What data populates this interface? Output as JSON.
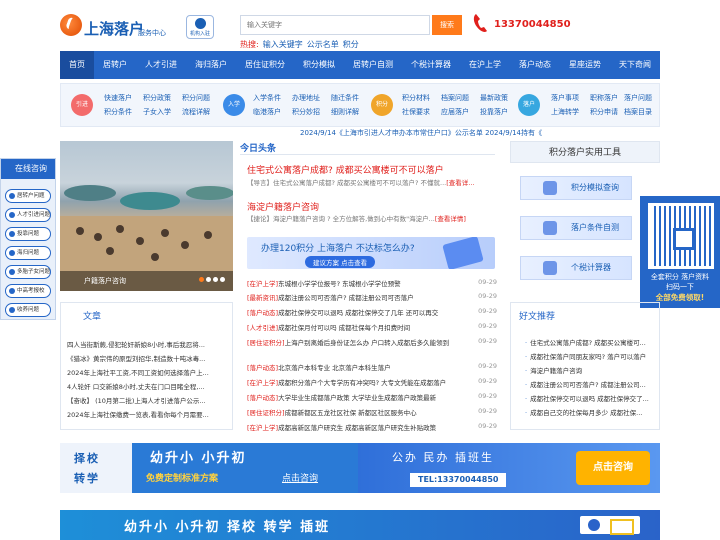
{
  "header": {
    "logo_text": "上海落户",
    "logo_sub": "服务中心",
    "org_badge": "机构入驻",
    "search_placeholder": "输入关键字",
    "search_button": "搜索",
    "hot_label": "热搜:",
    "hot_words": [
      "输入关键字",
      "公示名单",
      "积分"
    ],
    "phone": "13370044850"
  },
  "nav": [
    "首页",
    "居转户",
    "人才引进",
    "海归落户",
    "居住证积分",
    "积分模拟",
    "居转户自测",
    "个税计算器",
    "在沪上学",
    "落户动态",
    "星座运势",
    "天下奇闻"
  ],
  "categories": [
    {
      "badge": "引进",
      "color": "#f36b6b",
      "links": [
        "快速落户",
        "积分政策",
        "积分问题",
        "积分条件",
        "子女入学",
        "流程详解"
      ]
    },
    {
      "badge": "入学",
      "color": "#3b8be8",
      "links": [
        "入学条件",
        "办理地址",
        "随迁条件",
        "临港落户",
        "积分妙招",
        "细则详解"
      ]
    },
    {
      "badge": "积分",
      "color": "#f0a52a",
      "links": [
        "积分材料",
        "档案问题",
        "最新政策",
        "社保要求",
        "应届落户",
        "投靠落户"
      ]
    },
    {
      "badge": "落户",
      "color": "#37a7e0",
      "links": [
        "落户事项",
        "职称落户",
        "落户问题",
        "上海转学",
        "积分申请",
        "档案目录"
      ]
    }
  ],
  "ticker": "2024/9/14《上海市引进人才申办本市常住户口》公示名单   2024/9/14持有《",
  "photo_caption": "户籍落户咨询",
  "consult": {
    "title": "在线咨询",
    "items": [
      "居转户问题",
      "人才引进问题",
      "投靠问题",
      "海归问题",
      "多胎子女问题",
      "中高考报校",
      "收养问题"
    ]
  },
  "left_news": {
    "title": "文章",
    "items": [
      "四人当街斯蕨,侵犯轮奸新娘8小时,事后我忍将...",
      "《猎冰》黄宗伟的原型刘招华,制造数十吨冰毒...",
      "2024年上海社平工资,不同工资如何选择落户上...",
      "4人轮奸 口交新娘8小时,丈夫在门口目睹全程,...",
      "【奋收】 (10月第二批)上海人才引进落户公示...",
      "2024年上海社保缴费一览表,看看你每个月需要..."
    ]
  },
  "today": {
    "title": "今日头条",
    "headlines": [
      {
        "title": "住宅式公寓落户成都? 成都买公寓楼可不可以落户",
        "desc": "【导言】住宅式公寓落户成都? 成都买公寓楼可不可以落户? 不懂就...",
        "more": "[查看详..."
      },
      {
        "title": "海淀户籍落户咨询",
        "desc": "【捷论】海淀户籍落户咨询 ? 全方位解答,做到心中有数\"海淀户...",
        "more": "[查看详情]"
      }
    ],
    "banner_title": "办理120积分  上海落户   不达标怎么办?",
    "banner_btn": "建议方案    点击查看",
    "list": [
      {
        "tag": "[在沪上学]",
        "text": "东城根小学学位报号? 东城根小学学位预警",
        "date": "09-29"
      },
      {
        "tag": "[最新资讯]",
        "text": "成都注册公司可否落户? 成都注册公司可否落户",
        "date": "09-29"
      },
      {
        "tag": "[落户动态]",
        "text": "成都社保停交可以退吗 成都社保停交了几年 还可以再交",
        "date": "09-29"
      },
      {
        "tag": "[人才引进]",
        "text": "成都社保月付可以吗 成都社保每个月扣费时间",
        "date": "09-29"
      },
      {
        "tag": "[居住证积分]",
        "text": "上海户别离婚后身份证怎么办 户口转入成都后多久能领到",
        "date": "09-29"
      },
      {
        "tag": "[落户动态]",
        "text": "北京落户本科专业 北京落户本科生落户",
        "date": "09-29"
      },
      {
        "tag": "[在沪上学]",
        "text": "成都积分落户个大专学历有冲突吗? 大专文凭能在成都落户",
        "date": "09-29"
      },
      {
        "tag": "[落户动态]",
        "text": "大学毕业生成都落户政策 大学毕业生成都落户政策最新",
        "date": "09-29"
      },
      {
        "tag": "[居住证积分]",
        "text": "成都新都区五龙社区社保 新都区社区服务中心",
        "date": "09-29"
      },
      {
        "tag": "[在沪上学]",
        "text": "成都高新区落户研究生 成都高新区落户研究生补贴政策",
        "date": "09-29"
      }
    ]
  },
  "tools": {
    "title": "积分落户实用工具",
    "buttons": [
      "积分模拟查询",
      "落户条件自测",
      "个税计算器"
    ]
  },
  "qr": {
    "line1": "全套积分 落户资料",
    "line2": "扫码一下",
    "line3": "全部免费领取!"
  },
  "recommend": {
    "title": "好文推荐",
    "items": [
      "住宅式公寓落户成都? 成都买公寓楼可...",
      "成都社保落户同朋友家吗? 落户可以落户",
      "海淀户籍落户咨询",
      "成都注册公司可否落户? 成都注册公司...",
      "成都社保停交可以退吗 成都社保停交了...",
      "成都自己交的社保每月多少 成都社保..."
    ]
  },
  "banner1": {
    "left_words": [
      "择校",
      "转学"
    ],
    "mid_title": "幼升小  小升初",
    "mid_sub": "免费定制标准方案",
    "mid_link": "点击咨询",
    "right_title": "公办  民办  插班生",
    "tel": "TEL:13370044850",
    "cta": "点击咨询"
  },
  "banner2": {
    "text": "幼升小  小升初  择校  转学  插班"
  }
}
